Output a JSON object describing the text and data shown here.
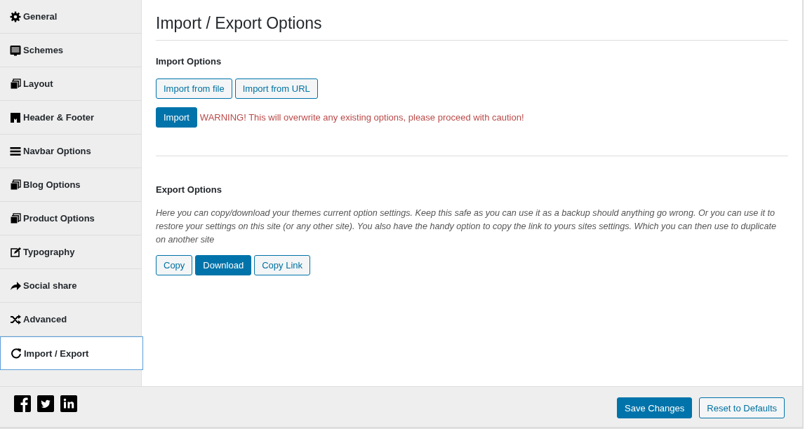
{
  "sidebar": {
    "items": [
      {
        "label": "General",
        "selected": false
      },
      {
        "label": "Schemes",
        "selected": false
      },
      {
        "label": "Layout",
        "selected": false
      },
      {
        "label": "Header & Footer",
        "selected": false
      },
      {
        "label": "Navbar Options",
        "selected": false
      },
      {
        "label": "Blog Options",
        "selected": false
      },
      {
        "label": "Product Options",
        "selected": false
      },
      {
        "label": "Typography",
        "selected": false
      },
      {
        "label": "Social share",
        "selected": false
      },
      {
        "label": "Advanced",
        "selected": false
      },
      {
        "label": "Import / Export",
        "selected": true
      }
    ]
  },
  "main": {
    "title": "Import / Export Options",
    "import": {
      "heading": "Import Options",
      "source_buttons": [
        {
          "label": "Import from file",
          "kind": "secondary"
        },
        {
          "label": "Import from URL",
          "kind": "secondary"
        }
      ],
      "import_button": {
        "label": "Import",
        "kind": "primary"
      },
      "warning": "WARNING! This will overwrite any existing options, please proceed with caution!"
    },
    "export": {
      "heading": "Export Options",
      "description": "Here you can copy/download your themes current option settings. Keep this safe as you can use it as a backup should anything go wrong. Or you can use it to restore your settings on this site (or any other site). You also have the handy option to copy the link to yours sites settings. Which you can then use to duplicate on another site",
      "buttons": [
        {
          "label": "Copy",
          "kind": "secondary"
        },
        {
          "label": "Download",
          "kind": "primary"
        },
        {
          "label": "Copy Link",
          "kind": "secondary"
        }
      ]
    }
  },
  "footer": {
    "buttons": [
      {
        "label": "Save Changes",
        "kind": "primary"
      },
      {
        "label": "Reset to Defaults",
        "kind": "secondary"
      }
    ]
  }
}
